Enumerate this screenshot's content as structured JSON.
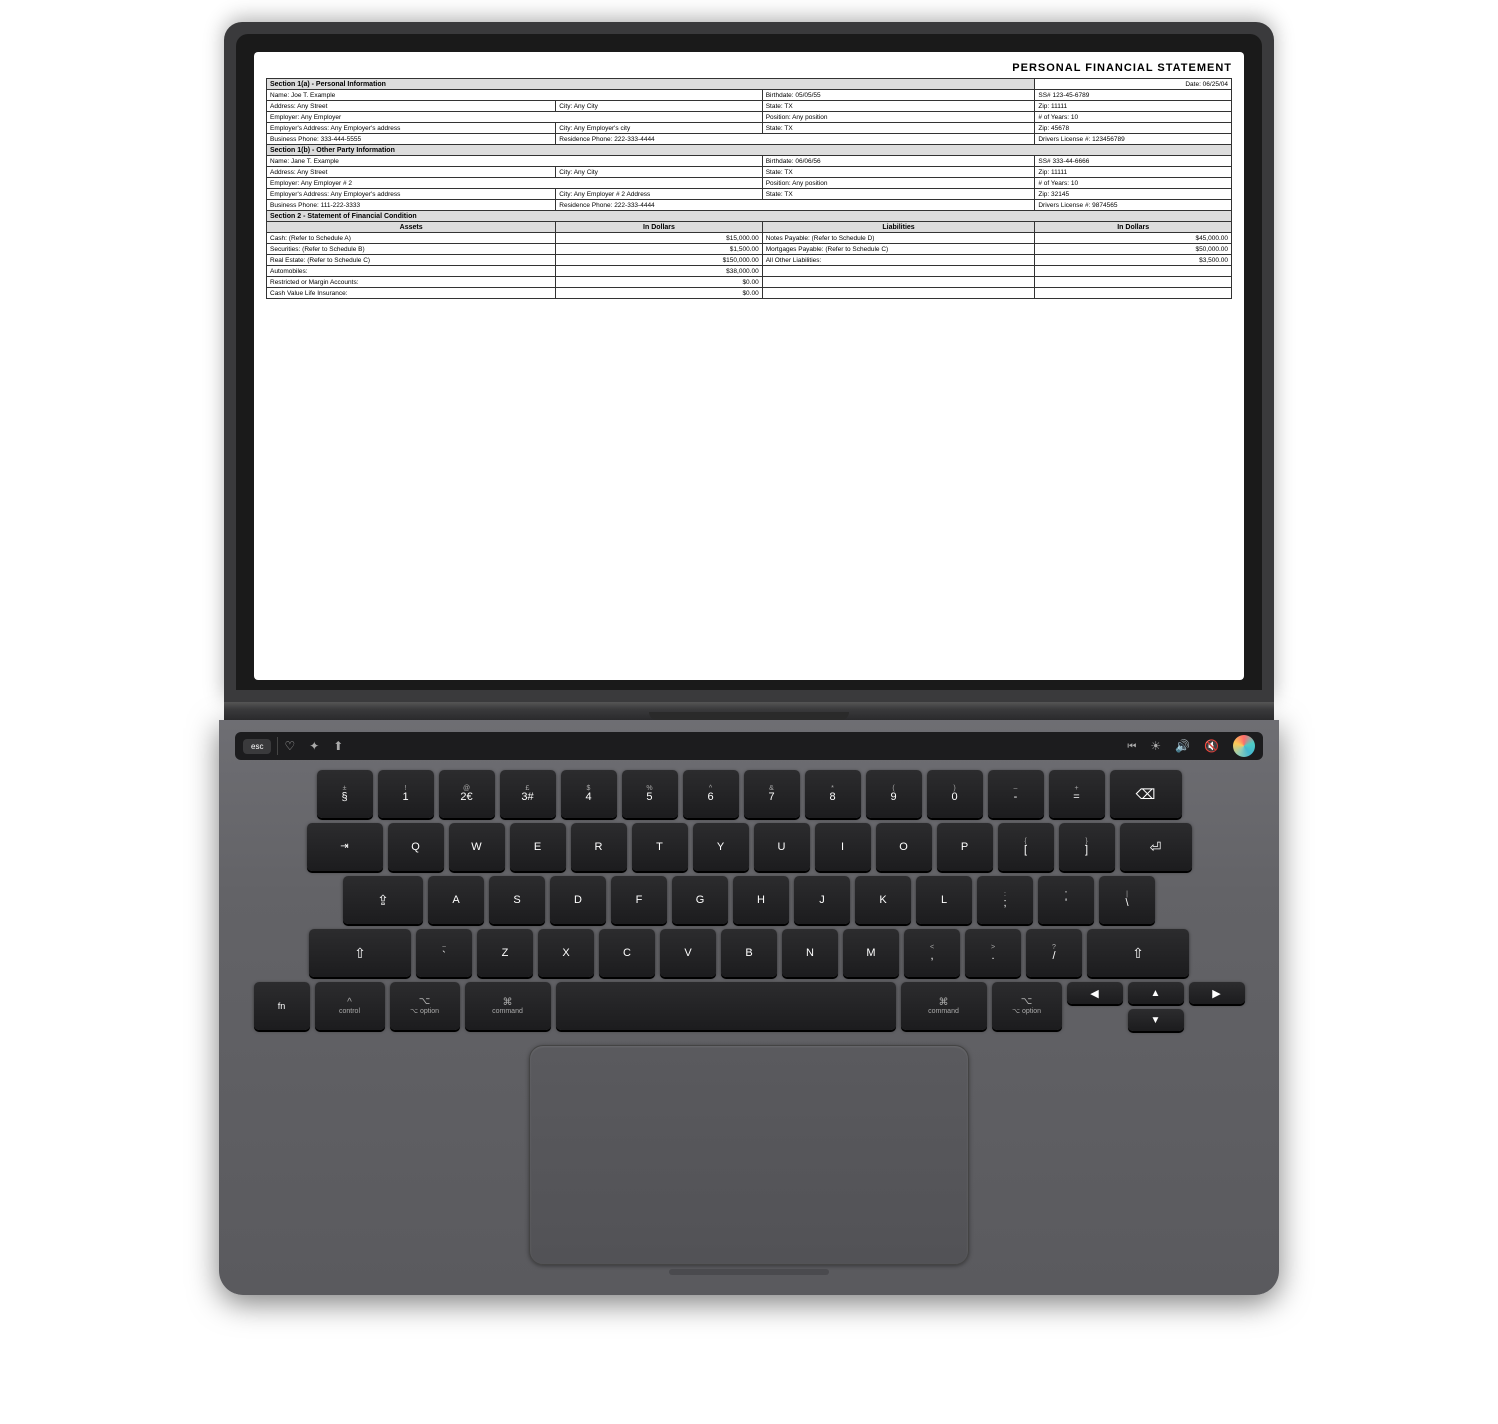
{
  "laptop": {
    "screen": {
      "document": {
        "title": "PERSONAL FINANCIAL STATEMENT",
        "date": "Date: 06/25/04",
        "section1a": {
          "header": "Section 1(a) - Personal Information",
          "rows": [
            [
              "Name: Joe T. Example",
              "Birthdate: 05/05/55",
              "SS# 123-45-6789"
            ],
            [
              "Address: Any Street",
              "City: Any City",
              "State: TX",
              "Zip: 11111"
            ],
            [
              "Employer: Any Employer",
              "Position: Any position",
              "# of Years: 10"
            ],
            [
              "Employer's Address: Any Employer's address",
              "City: Any Employer's city",
              "State: TX",
              "Zip: 45678"
            ],
            [
              "Business Phone: 333-444-5555",
              "Residence Phone: 222-333-4444",
              "Drivers License #: 123456789"
            ]
          ]
        },
        "section1b": {
          "header": "Section 1(b) - Other Party Information",
          "rows": [
            [
              "Name: Jane T. Example",
              "Birthdate: 06/06/56",
              "SS# 333-44-6666"
            ],
            [
              "Address: Any Street",
              "City: Any City",
              "State: TX",
              "Zip: 11111"
            ],
            [
              "Employer: Any Employer # 2",
              "Position: Any position",
              "# of Years: 10"
            ],
            [
              "Employer's Address: Any Employer's address",
              "City: Any Employer # 2 Address",
              "State: TX",
              "Zip: 32145"
            ],
            [
              "Business Phone: 111-222-3333",
              "Residence Phone: 222-333-4444",
              "Drivers License #: 9874565"
            ]
          ]
        },
        "section2": {
          "header": "Section 2 - Statement of Financial Condition",
          "assets_header": "Assets",
          "in_dollars": "In Dollars",
          "liabilities_header": "Liabilities",
          "assets": [
            [
              "Cash: (Refer to Schedule A)",
              "$15,000.00"
            ],
            [
              "Securities: (Refer to Schedule B)",
              "$1,500.00"
            ],
            [
              "Real Estate: (Refer to Schedule C)",
              "$150,000.00"
            ],
            [
              "Automobiles:",
              "$38,000.00"
            ],
            [
              "Restricted or Margin Accounts:",
              "$0.00"
            ],
            [
              "Cash Value Life Insurance:",
              "$0.00"
            ]
          ],
          "liabilities": [
            [
              "Notes Payable: (Refer to Schedule D)",
              "$45,000.00"
            ],
            [
              "Mortgages Payable: (Refer to Schedule C)",
              "$50,000.00"
            ],
            [
              "All Other Liabilities:",
              "$3,500.00"
            ]
          ]
        }
      }
    },
    "touchbar": {
      "esc": "esc",
      "icons": [
        "♡",
        "✦",
        "⬆"
      ],
      "right_icons": [
        "(",
        "☀",
        "🔊",
        "🔇"
      ]
    },
    "keyboard": {
      "row0": [
        {
          "label": "±\n§",
          "size": "k-std"
        },
        {
          "label": "!\n1",
          "size": "k-std"
        },
        {
          "label": "@\n2€",
          "size": "k-std"
        },
        {
          "label": "£\n3#",
          "size": "k-std"
        },
        {
          "label": "$\n4",
          "size": "k-std"
        },
        {
          "label": "%\n5",
          "size": "k-std"
        },
        {
          "label": "^\n6",
          "size": "k-std"
        },
        {
          "label": "&\n7",
          "size": "k-std"
        },
        {
          "label": "*\n8",
          "size": "k-std"
        },
        {
          "label": "(\n9",
          "size": "k-std"
        },
        {
          "label": ")\n0",
          "size": "k-std"
        },
        {
          "label": "–\n-",
          "size": "k-std"
        },
        {
          "label": "+\n=",
          "size": "k-std"
        },
        {
          "label": "⌫",
          "size": "k-backspace"
        }
      ],
      "row1": [
        {
          "label": "→\n⇥",
          "size": "k-tab"
        },
        {
          "label": "Q",
          "size": "k-std"
        },
        {
          "label": "W",
          "size": "k-std"
        },
        {
          "label": "E",
          "size": "k-std"
        },
        {
          "label": "R",
          "size": "k-std"
        },
        {
          "label": "T",
          "size": "k-std"
        },
        {
          "label": "Y",
          "size": "k-std"
        },
        {
          "label": "U",
          "size": "k-std"
        },
        {
          "label": "I",
          "size": "k-std"
        },
        {
          "label": "O",
          "size": "k-std"
        },
        {
          "label": "P",
          "size": "k-std"
        },
        {
          "label": "{\n[",
          "size": "k-std"
        },
        {
          "label": "}\n]",
          "size": "k-std"
        },
        {
          "label": "⏎",
          "size": "k-enter"
        }
      ],
      "row2": [
        {
          "label": "⇪",
          "size": "k-caps"
        },
        {
          "label": "A",
          "size": "k-std"
        },
        {
          "label": "S",
          "size": "k-std"
        },
        {
          "label": "D",
          "size": "k-std"
        },
        {
          "label": "F",
          "size": "k-std"
        },
        {
          "label": "G",
          "size": "k-std"
        },
        {
          "label": "H",
          "size": "k-std"
        },
        {
          "label": "J",
          "size": "k-std"
        },
        {
          "label": "K",
          "size": "k-std"
        },
        {
          "label": "L",
          "size": "k-std"
        },
        {
          "label": ":\n;",
          "size": "k-std"
        },
        {
          "label": "\"\n'",
          "size": "k-std"
        },
        {
          "label": "|\n\\",
          "size": "k-std"
        }
      ],
      "row3": [
        {
          "label": "⇧",
          "size": "k-lshift"
        },
        {
          "label": "~\n`",
          "size": "k-std"
        },
        {
          "label": "Z",
          "size": "k-std"
        },
        {
          "label": "X",
          "size": "k-std"
        },
        {
          "label": "C",
          "size": "k-std"
        },
        {
          "label": "V",
          "size": "k-std"
        },
        {
          "label": "B",
          "size": "k-std"
        },
        {
          "label": "N",
          "size": "k-std"
        },
        {
          "label": "M",
          "size": "k-std"
        },
        {
          "label": "<\n,",
          "size": "k-std"
        },
        {
          "label": ">\n.",
          "size": "k-std"
        },
        {
          "label": "?\n/",
          "size": "k-std"
        },
        {
          "label": "⇧",
          "size": "k-rshift"
        }
      ],
      "row4": [
        {
          "label": "fn",
          "size": "k-fn"
        },
        {
          "label": "^\ncontrol",
          "size": "k-ctrl"
        },
        {
          "label": "⌥\noption",
          "size": "k-opt"
        },
        {
          "label": "⌘\ncommand",
          "size": "k-cmd"
        },
        {
          "label": "",
          "size": "k-space"
        },
        {
          "label": "⌘\ncommand",
          "size": "k-cmd2"
        },
        {
          "label": "⌥\noption",
          "size": "k-opt2"
        }
      ]
    }
  }
}
